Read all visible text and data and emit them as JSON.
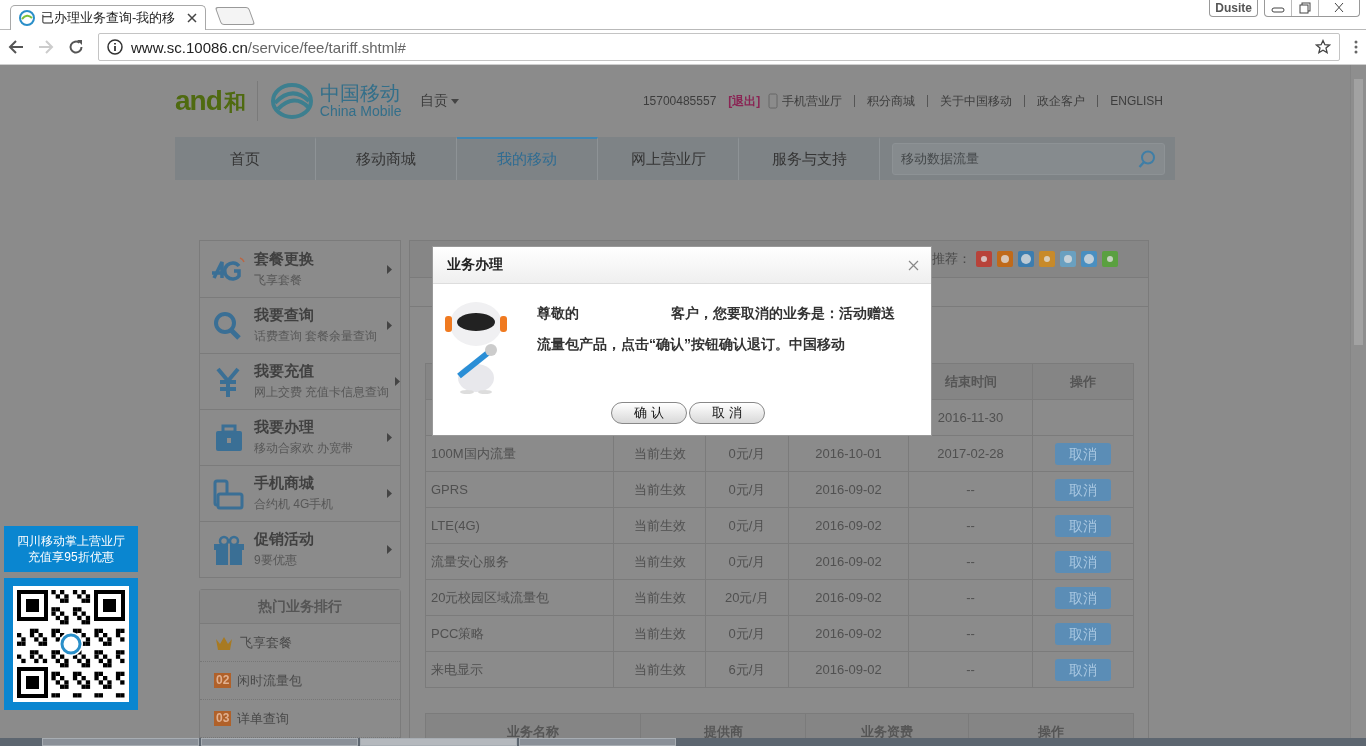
{
  "browser": {
    "tab_title": "已办理业务查询-我的移",
    "badge": "Dusite",
    "url_host": "www.sc.10086.cn",
    "url_path": "/service/fee/tariff.shtml#"
  },
  "header": {
    "and_logo": "and",
    "he_logo": "和",
    "brand_cn": "中国移动",
    "brand_en": "China Mobile",
    "city": "自贡",
    "phone": "15700485557",
    "logout": "[退出]",
    "links": [
      "手机营业厅",
      "积分商城",
      "关于中国移动",
      "政企客户",
      "ENGLISH"
    ]
  },
  "nav": {
    "tabs": [
      {
        "label": "首页",
        "selected": false
      },
      {
        "label": "移动商城",
        "selected": false
      },
      {
        "label": "我的移动",
        "selected": true
      },
      {
        "label": "网上营业厅",
        "selected": false
      },
      {
        "label": "服务与支持",
        "selected": false
      }
    ],
    "search": {
      "placeholder": "移动数据流量"
    }
  },
  "sidebar": {
    "items": [
      {
        "title": "套餐更换",
        "subtitle": "飞享套餐"
      },
      {
        "title": "我要查询",
        "subtitle": "话费查询 套餐余量查询"
      },
      {
        "title": "我要充值",
        "subtitle": "网上交费 充值卡信息查询"
      },
      {
        "title": "我要办理",
        "subtitle": "移动合家欢 办宽带"
      },
      {
        "title": "手机商城",
        "subtitle": "合约机 4G手机"
      },
      {
        "title": "促销活动",
        "subtitle": "9要优惠"
      }
    ],
    "hot": {
      "title": "热门业务排行",
      "items": [
        {
          "label": "飞享套餐"
        },
        {
          "rank": "02",
          "label": "闲时流量包"
        },
        {
          "rank": "03",
          "label": "详单查询"
        }
      ]
    }
  },
  "ad": {
    "lines": [
      "四川移动掌上营业厅",
      "充值享95折优惠"
    ]
  },
  "panel": {
    "recommend_label": "推荐：",
    "table": {
      "columns": {
        "end": "结束时间",
        "action": "操作"
      },
      "rows": [
        {
          "end": "2016-11-30"
        },
        {
          "name": "100M国内流量",
          "status": "当前生效",
          "fee": "0元/月",
          "start": "2016-10-01",
          "end": "2017-02-28",
          "action": "取消"
        },
        {
          "name": "GPRS",
          "status": "当前生效",
          "fee": "0元/月",
          "start": "2016-09-02",
          "end": "--",
          "action": "取消"
        },
        {
          "name": "LTE(4G)",
          "status": "当前生效",
          "fee": "0元/月",
          "start": "2016-09-02",
          "end": "--",
          "action": "取消"
        },
        {
          "name": "流量安心服务",
          "status": "当前生效",
          "fee": "0元/月",
          "start": "2016-09-02",
          "end": "--",
          "action": "取消"
        },
        {
          "name": "20元校园区域流量包",
          "status": "当前生效",
          "fee": "20元/月",
          "start": "2016-09-02",
          "end": "--",
          "action": "取消"
        },
        {
          "name": "PCC策略",
          "status": "当前生效",
          "fee": "0元/月",
          "start": "2016-09-02",
          "end": "--",
          "action": "取消"
        },
        {
          "name": "来电显示",
          "status": "当前生效",
          "fee": "6元/月",
          "start": "2016-09-02",
          "end": "--",
          "action": "取消"
        }
      ]
    },
    "table2": {
      "columns": [
        "业务名称",
        "提供商",
        "业务资费",
        "操作"
      ]
    }
  },
  "dialog": {
    "title": "业务办理",
    "greeting": "尊敬的",
    "message": "客户，您要取消的业务是：活动赠送流量包产品，点击“确认”按钮确认退订。中国移动",
    "buttons": [
      "确 认",
      "取 消"
    ]
  }
}
